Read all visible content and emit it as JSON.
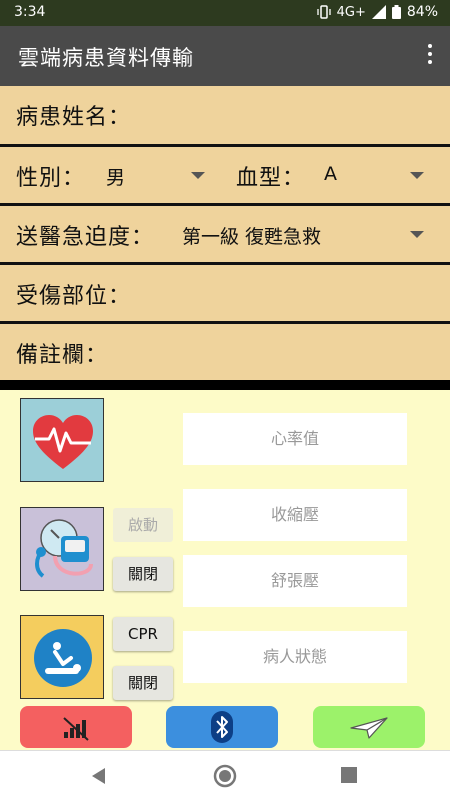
{
  "status": {
    "time": "3:34",
    "network": "4G+",
    "battery": "84%"
  },
  "app": {
    "title": "雲端病患資料傳輸"
  },
  "form": {
    "patient_name_label": "病患姓名：",
    "gender_label": "性別：",
    "gender_value": "男",
    "blood_type_label": "血型：",
    "blood_type_value": "A",
    "urgency_label": "送醫急迫度：",
    "urgency_value": "第一級 復甦急救",
    "injury_label": "受傷部位：",
    "notes_label": "備註欄："
  },
  "vitals": {
    "heart_rate_placeholder": "心率值",
    "start_button": "啟動",
    "systolic_placeholder": "收縮壓",
    "close_button_1": "關閉",
    "diastolic_placeholder": "舒張壓",
    "cpr_button": "CPR",
    "patient_status_placeholder": "病人狀態",
    "close_button_2": "關閉"
  },
  "colors": {
    "form_bg": "#efd39c",
    "panel_bg": "#fdfbc8",
    "no_signal_btn": "#f46060",
    "bluetooth_btn": "#3c8fde",
    "send_btn": "#9cf26a"
  },
  "icons": [
    "heart-rate-icon",
    "blood-pressure-icon",
    "cpr-icon",
    "no-signal-icon",
    "bluetooth-icon",
    "send-icon",
    "back-icon",
    "home-icon",
    "recents-icon"
  ]
}
